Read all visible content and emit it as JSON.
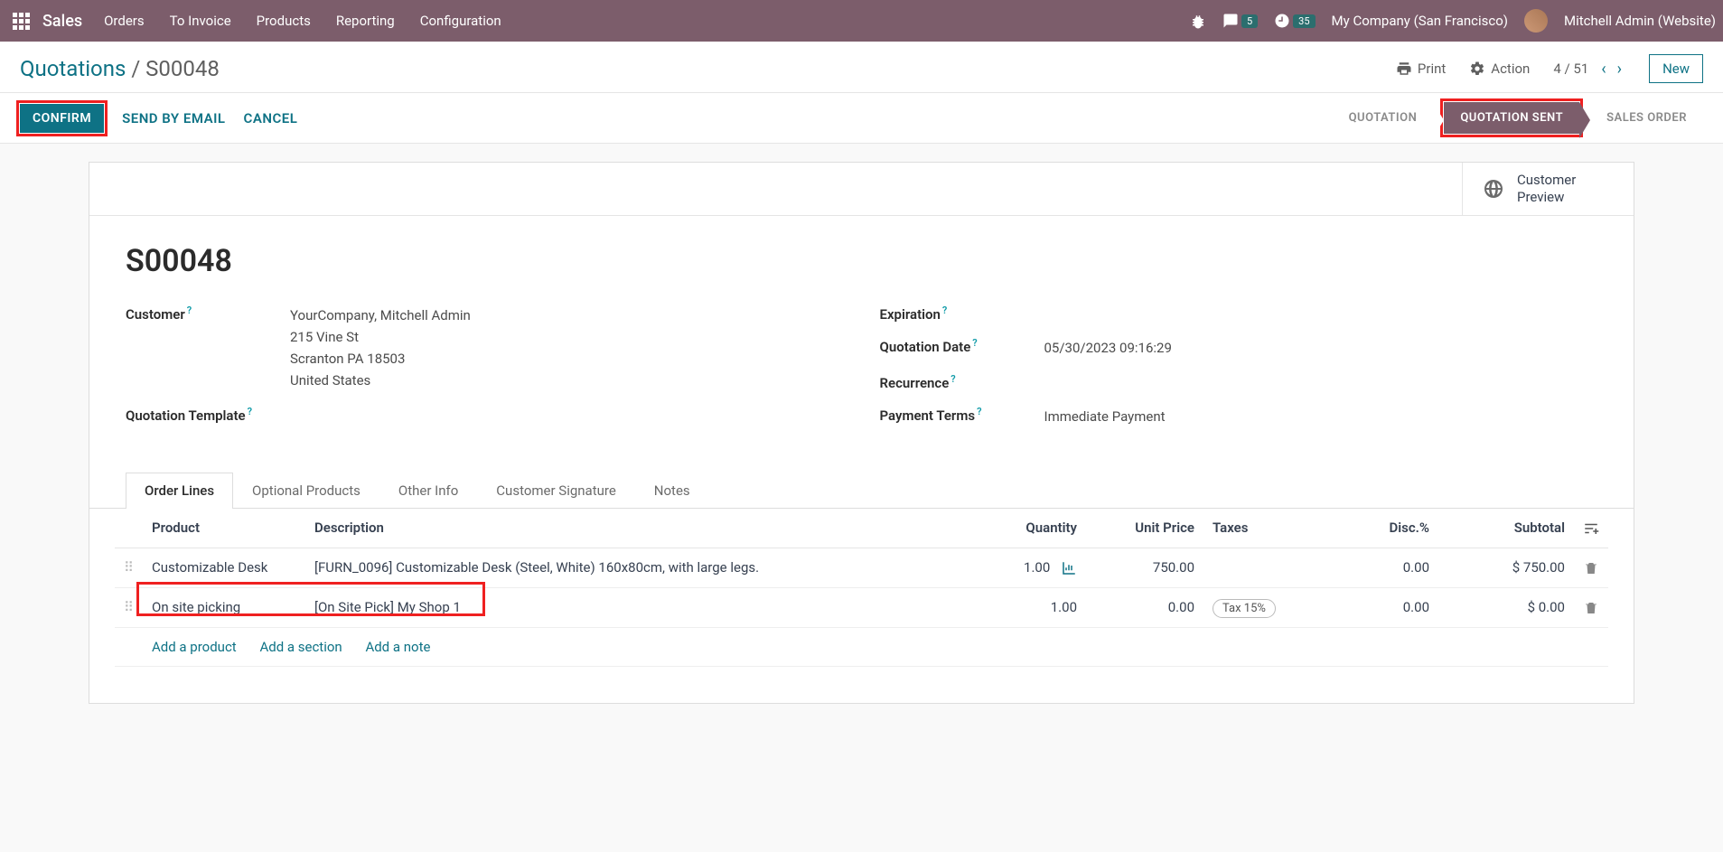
{
  "topnav": {
    "brand": "Sales",
    "items": [
      "Orders",
      "To Invoice",
      "Products",
      "Reporting",
      "Configuration"
    ],
    "msg_badge": "5",
    "clock_badge": "35",
    "company": "My Company (San Francisco)",
    "user": "Mitchell Admin (Website)"
  },
  "crumb": {
    "root": "Quotations",
    "current": "S00048"
  },
  "toolbar": {
    "print": "Print",
    "action": "Action",
    "pager": "4 / 51",
    "new": "New"
  },
  "actions": {
    "confirm": "CONFIRM",
    "send_email": "SEND BY EMAIL",
    "cancel": "CANCEL"
  },
  "status": {
    "quotation": "QUOTATION",
    "quotation_sent": "QUOTATION SENT",
    "sales_order": "SALES ORDER"
  },
  "preview": {
    "line1": "Customer",
    "line2": "Preview"
  },
  "record": {
    "name": "S00048",
    "labels": {
      "customer": "Customer",
      "quote_tmpl": "Quotation Template",
      "expiration": "Expiration",
      "quote_date": "Quotation Date",
      "recurrence": "Recurrence",
      "pay_terms": "Payment Terms"
    },
    "customer_name": "YourCompany, Mitchell Admin",
    "addr1": "215 Vine St",
    "addr2": "Scranton PA 18503",
    "addr3": "United States",
    "quote_date": "05/30/2023 09:16:29",
    "pay_terms": "Immediate Payment"
  },
  "tabs": [
    "Order Lines",
    "Optional Products",
    "Other Info",
    "Customer Signature",
    "Notes"
  ],
  "table": {
    "headers": {
      "product": "Product",
      "desc": "Description",
      "qty": "Quantity",
      "uprice": "Unit Price",
      "taxes": "Taxes",
      "disc": "Disc.%",
      "subtotal": "Subtotal"
    },
    "rows": [
      {
        "product": "Customizable Desk",
        "desc": "[FURN_0096] Customizable Desk (Steel, White) 160x80cm, with large legs.",
        "qty": "1.00",
        "uprice": "750.00",
        "taxes": "",
        "disc": "0.00",
        "subtotal": "$ 750.00",
        "has_chart": true
      },
      {
        "product": "On site picking",
        "desc": "[On Site Pick] My Shop 1",
        "qty": "1.00",
        "uprice": "0.00",
        "taxes": "Tax 15%",
        "disc": "0.00",
        "subtotal": "$ 0.00",
        "has_chart": false
      }
    ],
    "add": {
      "product": "Add a product",
      "section": "Add a section",
      "note": "Add a note"
    }
  }
}
